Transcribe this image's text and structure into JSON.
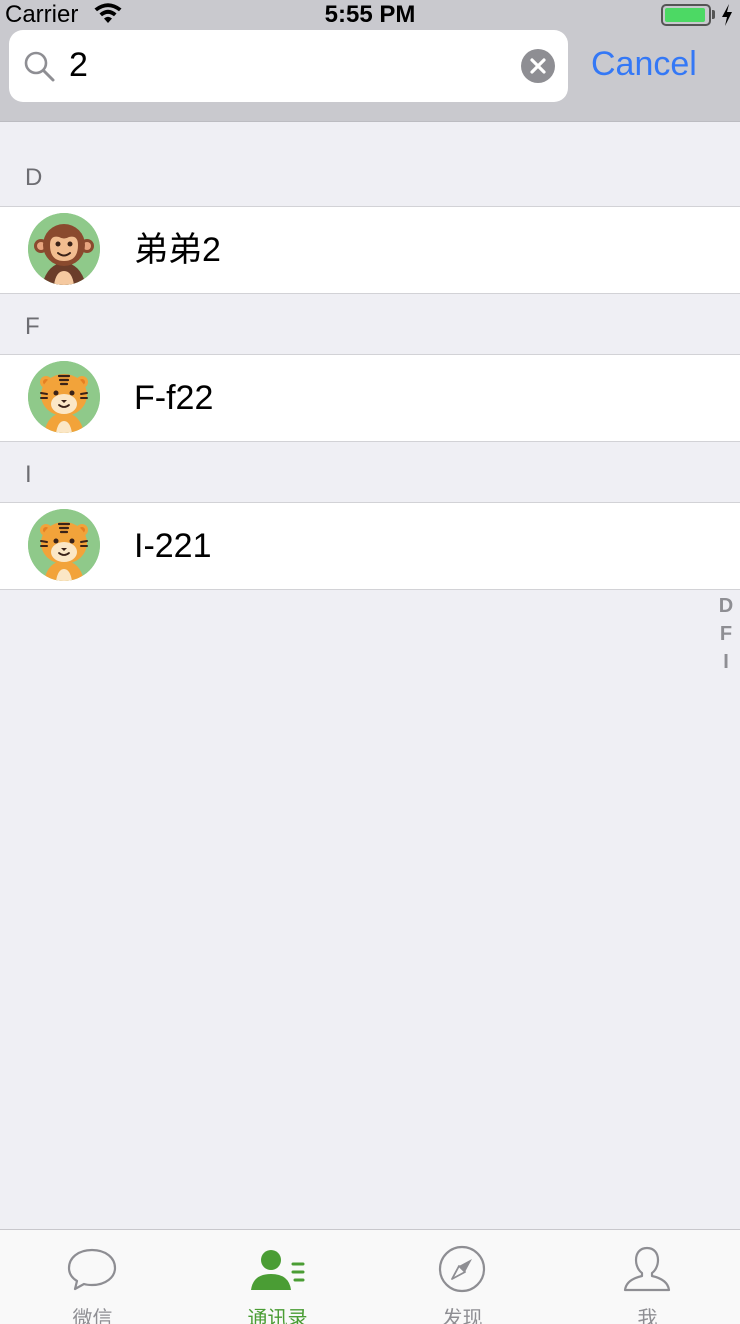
{
  "status_bar": {
    "carrier": "Carrier",
    "time": "5:55 PM"
  },
  "search": {
    "value": "2",
    "cancel_label": "Cancel"
  },
  "sections": [
    {
      "letter": "D",
      "contacts": [
        {
          "name": "弟弟2",
          "avatar": "monkey-avatar"
        }
      ]
    },
    {
      "letter": "F",
      "contacts": [
        {
          "name": "F-f22",
          "avatar": "tiger-avatar"
        }
      ]
    },
    {
      "letter": "I",
      "contacts": [
        {
          "name": "I-221",
          "avatar": "tiger-avatar"
        }
      ]
    }
  ],
  "index": [
    "D",
    "F",
    "I"
  ],
  "tab_bar": {
    "tabs": [
      {
        "label": "微信",
        "icon": "chat-bubble-icon",
        "active": false
      },
      {
        "label": "通讯录",
        "icon": "contacts-icon",
        "active": true
      },
      {
        "label": "发现",
        "icon": "compass-icon",
        "active": false
      },
      {
        "label": "我",
        "icon": "person-icon",
        "active": false
      }
    ]
  },
  "colors": {
    "accent_blue": "#3478f6",
    "active_green": "#4a9d34",
    "battery_green": "#4cd964",
    "background": "#efeff4"
  }
}
